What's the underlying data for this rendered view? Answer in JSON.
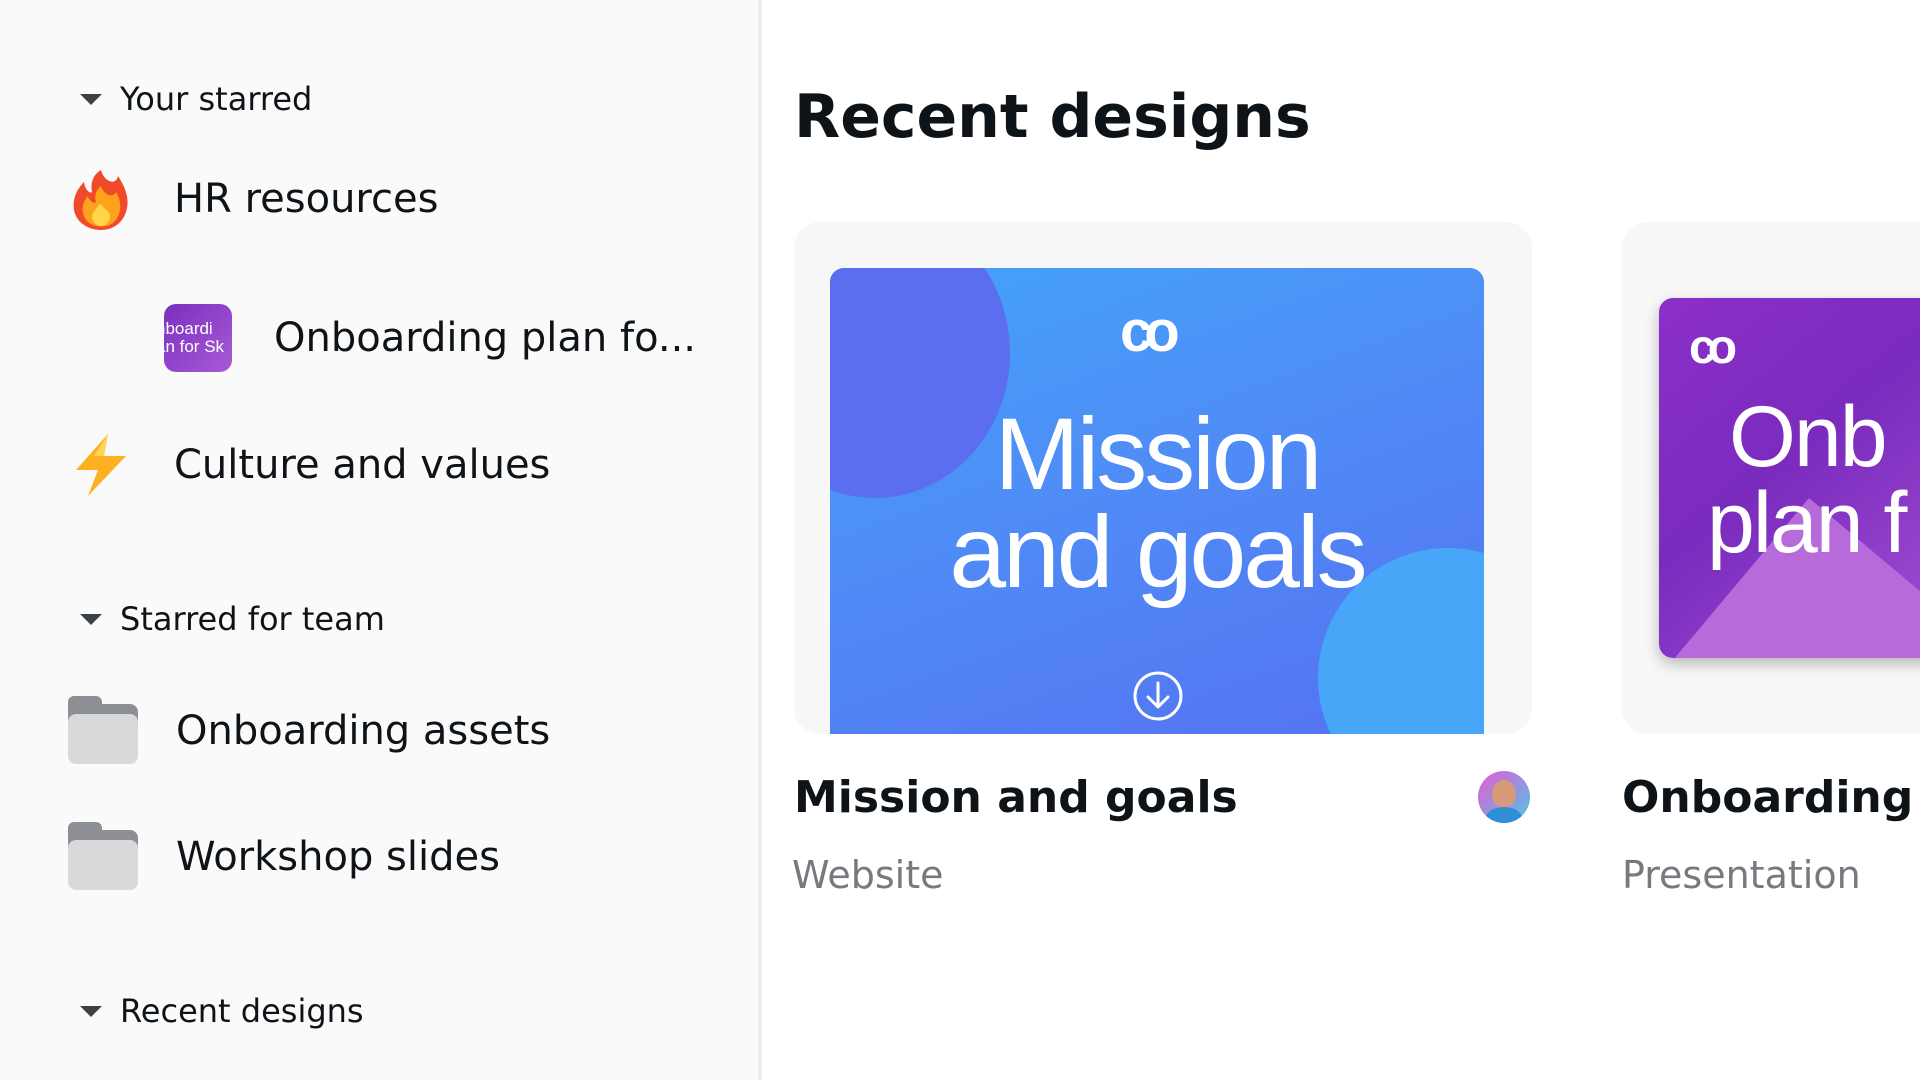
{
  "sidebar": {
    "your_starred": {
      "header": "Your starred",
      "items": [
        {
          "label": "HR resources",
          "icon": "fire-icon"
        },
        {
          "label": "Onboarding plan fo...",
          "icon": "design-thumbnail",
          "thumb_text": [
            "nboardi",
            "an for Sk"
          ]
        },
        {
          "label": "Culture and values",
          "icon": "lightning-icon"
        }
      ]
    },
    "starred_for_team": {
      "header": "Starred for team",
      "items": [
        {
          "label": "Onboarding assets",
          "icon": "folder-icon"
        },
        {
          "label": "Workshop slides",
          "icon": "folder-icon"
        }
      ]
    },
    "recent_designs": {
      "header": "Recent designs"
    }
  },
  "main": {
    "title": "Recent designs",
    "cards": [
      {
        "title": "Mission and goals",
        "type": "Website",
        "preview": {
          "line1": "Mission",
          "line2": "and goals",
          "logo": "co"
        },
        "accent": "#4f8cf6"
      },
      {
        "title": "Onboarding p",
        "type": "Presentation",
        "preview": {
          "line1": "Onb",
          "line2": "plan f",
          "logo": "co"
        },
        "accent": "#8b2fc9"
      }
    ]
  }
}
